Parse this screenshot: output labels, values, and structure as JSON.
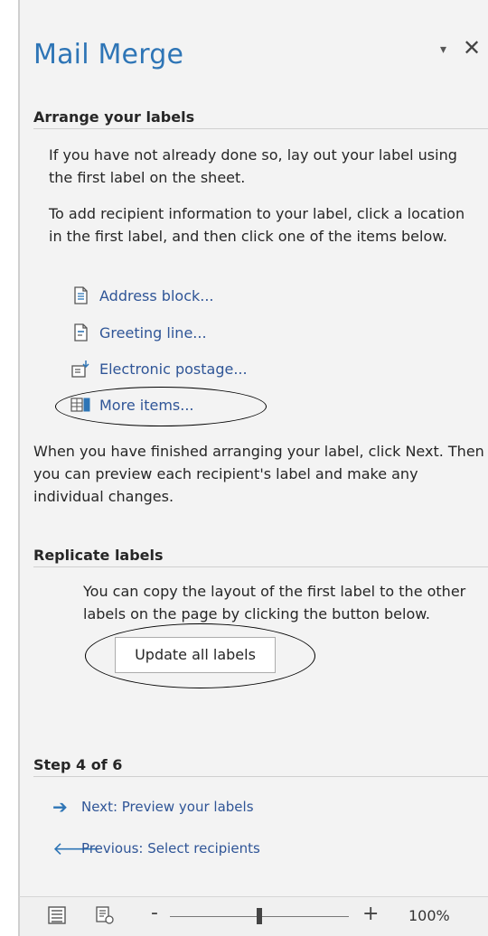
{
  "pane": {
    "title": "Mail Merge",
    "dropdown_icon": "▾",
    "close_icon": "✕"
  },
  "arrange": {
    "heading": "Arrange your labels",
    "intro": "If you have not already done so, lay out your label using the first label on the sheet.",
    "instruction": "To add recipient information to your label, click a location in the first label, and then click one of the items below.",
    "items": [
      {
        "label": "Address block...",
        "icon": "address-block-icon"
      },
      {
        "label": "Greeting line...",
        "icon": "greeting-line-icon"
      },
      {
        "label": "Electronic postage...",
        "icon": "electronic-postage-icon"
      },
      {
        "label": "More items...",
        "icon": "more-items-icon"
      }
    ],
    "finish": "When you have finished arranging your label, click Next. Then you can preview each recipient's label and make any individual changes."
  },
  "replicate": {
    "heading": "Replicate labels",
    "text": "You can copy the layout of the first label to the other labels on the page by clicking the button below.",
    "button": "Update all labels"
  },
  "step": {
    "heading": "Step 4 of 6",
    "next": "Next: Preview your labels",
    "previous": "Previous: Select recipients"
  },
  "statusbar": {
    "zoom": "100%",
    "zoom_minus": "-",
    "zoom_plus": "+",
    "zoom_level": 0.5
  }
}
